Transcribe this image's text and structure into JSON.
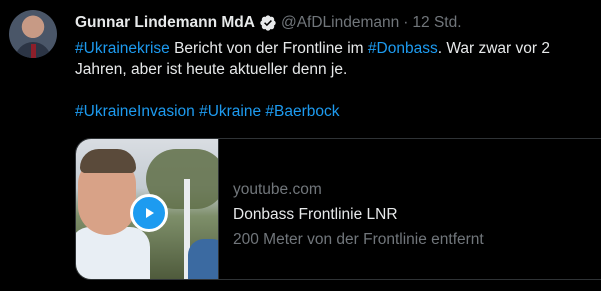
{
  "tweet": {
    "author_name": "Gunnar Lindemann MdA",
    "handle": "@AfDLindemann",
    "separator": "·",
    "time": "12 Std.",
    "line1": {
      "tag1": "#Ukrainekrise",
      "text1": " Bericht von der Frontline im ",
      "tag2": "#Donbass",
      "text2": ". War zwar vor 2"
    },
    "line2": "Jahren, aber ist heute aktueller denn je.",
    "hashtags": [
      "#UkraineInvasion",
      "#Ukraine",
      "#Baerbock"
    ]
  },
  "card": {
    "domain": "youtube.com",
    "title": "Donbass Frontlinie LNR",
    "description": "200 Meter von der Frontlinie entfernt"
  },
  "colors": {
    "background": "#000000",
    "text": "#e7e9ea",
    "muted": "#71767b",
    "accent": "#1d9bf0",
    "border": "#2f3336"
  },
  "icons": {
    "verified": "verified-badge-icon",
    "play": "play-icon"
  }
}
